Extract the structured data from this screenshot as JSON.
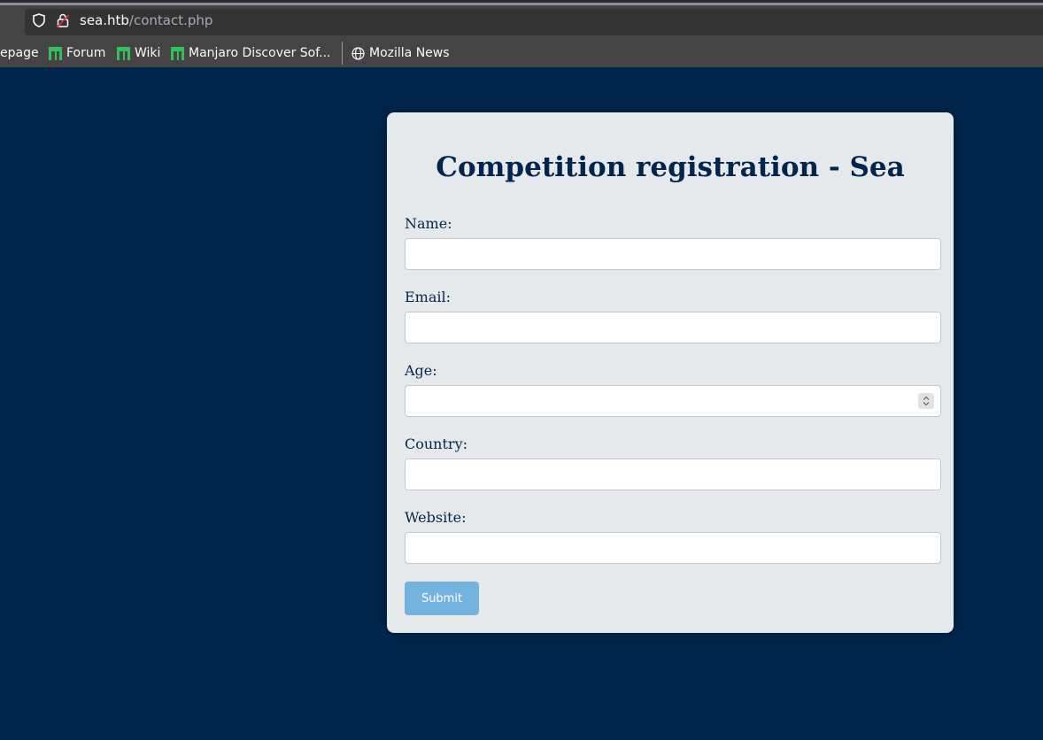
{
  "browser": {
    "url_host": "sea.htb",
    "url_path": "/contact.php",
    "bookmarks": [
      {
        "label": "epage",
        "icon": "manjaro-icon"
      },
      {
        "label": "Forum",
        "icon": "manjaro-icon"
      },
      {
        "label": "Wiki",
        "icon": "manjaro-icon"
      },
      {
        "label": "Manjaro Discover Sof...",
        "icon": "manjaro-icon"
      },
      {
        "label": "Mozilla News",
        "icon": "globe-icon"
      }
    ]
  },
  "form": {
    "title": "Competition registration - Sea",
    "fields": [
      {
        "label": "Name:",
        "value": ""
      },
      {
        "label": "Email:",
        "value": ""
      },
      {
        "label": "Age:",
        "value": ""
      },
      {
        "label": "Country:",
        "value": ""
      },
      {
        "label": "Website:",
        "value": ""
      }
    ],
    "submit_label": "Submit"
  },
  "colors": {
    "page_bg": "#00264d",
    "card_bg": "#e6e9ec",
    "accent": "#73b3e0",
    "manjaro_green": "#35bf5c"
  }
}
